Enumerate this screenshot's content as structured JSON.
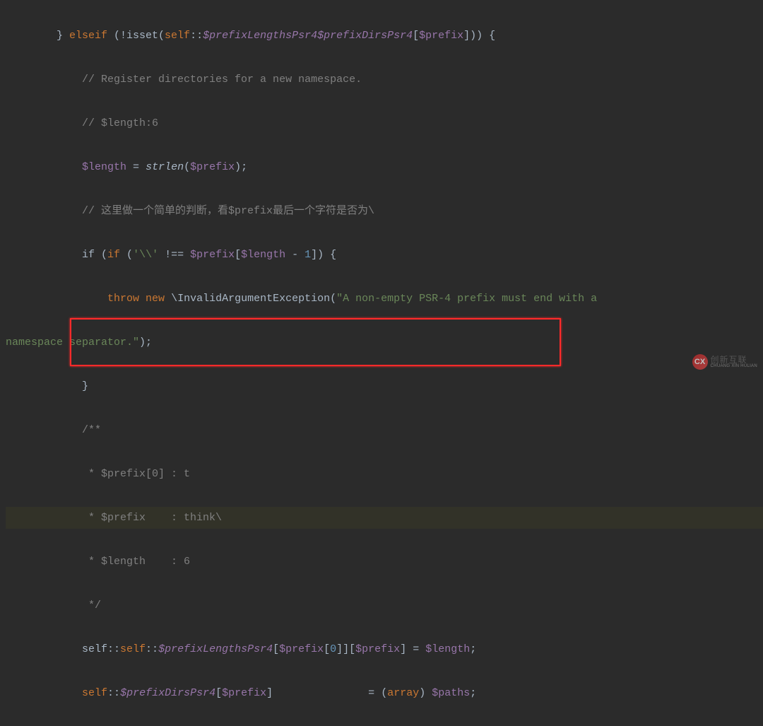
{
  "code": {
    "l1": "        } elseif (!isset(self::$prefixDirsPsr4[$prefix])) {",
    "l2": "            // Register directories for a new namespace.",
    "l3": "            // $length:6",
    "l4_a": "            ",
    "l4_var": "$length",
    "l4_b": " = ",
    "l4_fn": "strlen",
    "l4_c": "(",
    "l4_var2": "$prefix",
    "l4_d": ");",
    "l5": "            // 这里做一个简单的判断，看$prefix最后一个字符是否为\\",
    "l6_a": "            if (",
    "l6_str": "'\\\\'",
    "l6_b": " !== ",
    "l6_var": "$prefix",
    "l6_c": "[",
    "l6_var2": "$length",
    "l6_d": " - ",
    "l6_num": "1",
    "l6_e": "]) {",
    "l7_a": "                throw new ",
    "l7_cls": "\\InvalidArgumentException",
    "l7_b": "(",
    "l7_str": "\"A non-empty PSR-4 prefix must end with a ",
    "l7cont": "namespace separator.\"",
    "l7_c": ");",
    "l8": "            }",
    "l9": "            /**",
    "l10": "             * $prefix[0] : t",
    "l11": "             * $prefix    : think\\",
    "l12": "             * $length    : 6",
    "l13": "             */",
    "l14_a": "            self::",
    "l14_var": "$prefixLengthsPsr4",
    "l14_b": "[",
    "l14_var2": "$prefix",
    "l14_c": "[",
    "l14_num": "0",
    "l14_d": "]][",
    "l14_var3": "$prefix",
    "l14_e": "] = ",
    "l14_var4": "$length",
    "l14_f": ";",
    "l15_a": "            self::",
    "l15_var": "$prefixDirsPsr4",
    "l15_b": "[",
    "l15_var2": "$prefix",
    "l15_c": "]",
    "l15_pad": "               ",
    "l15_d": "= (array) ",
    "l15_var3": "$paths",
    "l15_e": ";"
  },
  "watermark": {
    "logo": "CX",
    "main": "创新互联",
    "sub": "CHUANG XIN HULIAN"
  }
}
